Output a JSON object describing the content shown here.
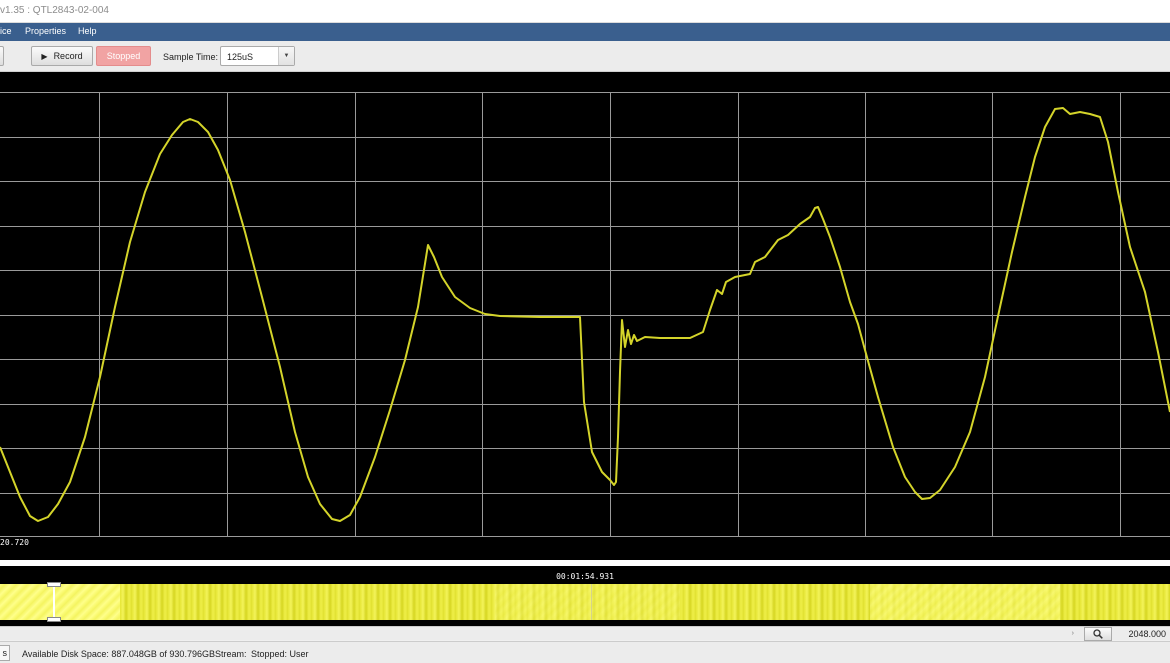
{
  "window": {
    "title": "v1.35 : QTL2843-02-004"
  },
  "menu": {
    "items": [
      "ice",
      "Properties",
      "Help"
    ]
  },
  "toolbar": {
    "left_stub_label": "",
    "record_label": "Record",
    "status_label": "Stopped",
    "sample_time_label": "Sample Time:",
    "sample_time_value": "125uS"
  },
  "scope": {
    "readout": "20.720",
    "trace_color": "#d4d42a",
    "grid_color": "#9a9a9a"
  },
  "overview": {
    "timestamp": "00:01:54.931",
    "band_color": "#e8e83a"
  },
  "zoom": {
    "value": "2048.000"
  },
  "status": {
    "left_stub_label": "s",
    "disk_space": "Available Disk Space: 887.048GB of 930.796GB",
    "stream_label": "Stream:",
    "stream_value": "Stopped: User"
  }
}
